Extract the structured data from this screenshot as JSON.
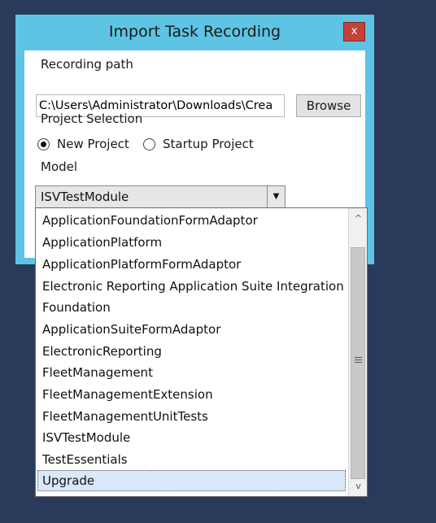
{
  "dialog": {
    "title": "Import Task Recording",
    "close_label": "x"
  },
  "recording": {
    "label": "Recording path",
    "path_value": "C:\\Users\\Administrator\\Downloads\\Crea",
    "browse_label": "Browse"
  },
  "project": {
    "label": "Project Selection",
    "options": [
      {
        "label": "New Project",
        "selected": true
      },
      {
        "label": "Startup Project",
        "selected": false
      }
    ]
  },
  "model": {
    "label": "Model",
    "selected_value": "ISVTestModule",
    "options": [
      "ApplicationFoundationFormAdaptor",
      "ApplicationPlatform",
      "ApplicationPlatformFormAdaptor",
      "Electronic Reporting Application Suite Integration",
      "Foundation",
      "ApplicationSuiteFormAdaptor",
      "ElectronicReporting",
      "FleetManagement",
      "FleetManagementExtension",
      "FleetManagementUnitTests",
      "ISVTestModule",
      "TestEssentials",
      "Upgrade"
    ],
    "highlighted_option": "Upgrade"
  },
  "icons": {
    "close": "close-icon",
    "dropdown": "chevron-down-icon",
    "scroll_up": "chevron-up-icon",
    "scroll_down": "chevron-down-icon",
    "grip": "grip-icon"
  },
  "colors": {
    "desktop": "#293a5a",
    "dialog_frame": "#5ec4e4",
    "close_button": "#c4413a",
    "selection": "#d8e8f8"
  }
}
